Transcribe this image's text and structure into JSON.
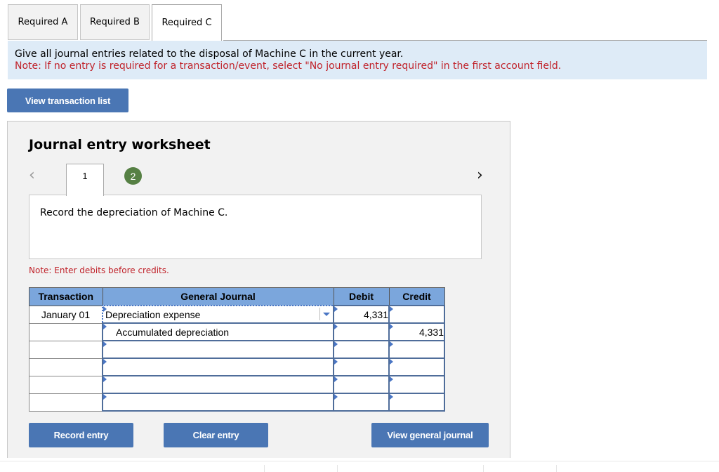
{
  "tabs": [
    {
      "label": "Required A",
      "active": false
    },
    {
      "label": "Required B",
      "active": false
    },
    {
      "label": "Required C",
      "active": true
    }
  ],
  "instructions": {
    "main": "Give all journal entries related to the disposal of Machine C in the current year.",
    "note": "Note: If no entry is required for a transaction/event, select \"No journal entry required\" in the first account field."
  },
  "buttons": {
    "view_transaction_list": "View transaction list",
    "record_entry": "Record entry",
    "clear_entry": "Clear entry",
    "view_general_journal": "View general journal"
  },
  "worksheet": {
    "title": "Journal entry worksheet",
    "prev_icon": "chevron-left-icon",
    "next_icon": "chevron-right-icon",
    "steps": [
      {
        "label": "1",
        "current": true
      },
      {
        "label": "2",
        "completed": true
      }
    ],
    "description": "Record the depreciation of Machine C.",
    "note": "Note: Enter debits before credits."
  },
  "journal": {
    "headers": [
      "Transaction",
      "General Journal",
      "Debit",
      "Credit"
    ],
    "rows": [
      {
        "transaction": "January 01",
        "account": "Depreciation expense",
        "debit": "4,331",
        "credit": ""
      },
      {
        "transaction": "",
        "account": "Accumulated depreciation",
        "debit": "",
        "credit": "4,331"
      },
      {
        "transaction": "",
        "account": "",
        "debit": "",
        "credit": ""
      },
      {
        "transaction": "",
        "account": "",
        "debit": "",
        "credit": ""
      },
      {
        "transaction": "",
        "account": "",
        "debit": "",
        "credit": ""
      },
      {
        "transaction": "",
        "account": "",
        "debit": "",
        "credit": ""
      }
    ]
  }
}
